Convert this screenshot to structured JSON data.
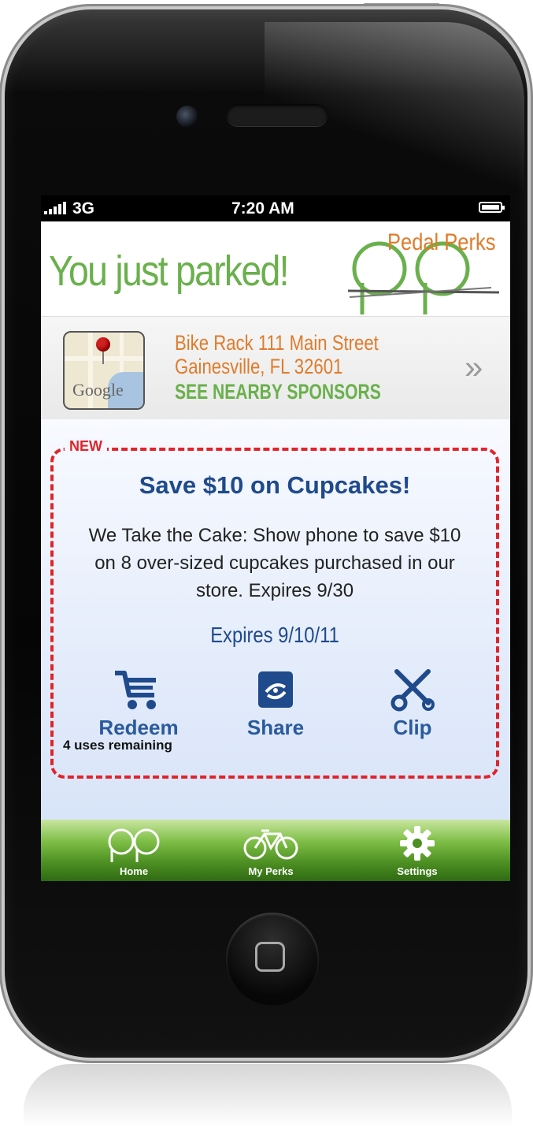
{
  "status_bar": {
    "carrier": "3G",
    "time": "7:20 AM"
  },
  "header": {
    "title": "You just parked!",
    "logo_text": "Pedal Perks"
  },
  "location": {
    "map_label": "Google",
    "line1": "Bike Rack 111 Main Street",
    "line2": "Gainesville, FL 32601",
    "sponsors_link": "SEE NEARBY SPONSORS",
    "chevron": "»"
  },
  "deal": {
    "badge": "NEW",
    "title": "Save $10 on Cupcakes!",
    "description": "We Take the Cake: Show phone to save $10 on 8 over-sized cupcakes purchased in our store. Expires 9/30",
    "expires": "Expires 9/10/11",
    "actions": [
      {
        "label": "Redeem",
        "icon": "cart-icon"
      },
      {
        "label": "Share",
        "icon": "share-icon"
      },
      {
        "label": "Clip",
        "icon": "scissors-icon"
      }
    ],
    "uses_remaining": "4 uses remaining"
  },
  "tabbar": {
    "items": [
      {
        "label": "Home",
        "icon": "pedal-perks-logo-icon"
      },
      {
        "label": "My Perks",
        "icon": "bicycle-icon"
      },
      {
        "label": "Settings",
        "icon": "gear-icon"
      }
    ]
  },
  "colors": {
    "brand_green": "#6ab04c",
    "brand_orange": "#e07b2a",
    "deal_blue": "#1f4a8c",
    "dashed_red": "#e0242a"
  }
}
